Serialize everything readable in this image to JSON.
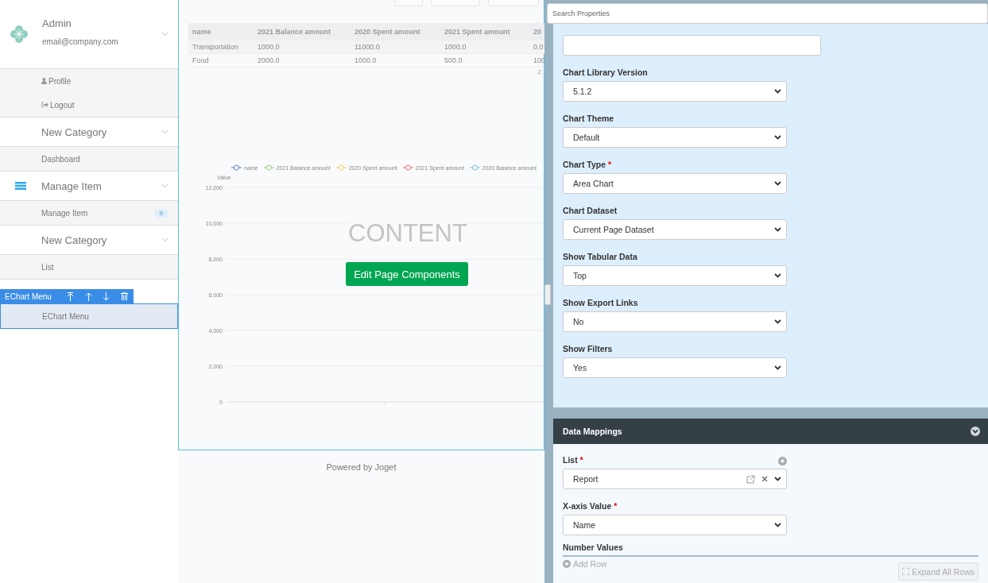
{
  "sidebar": {
    "profile": {
      "name": "Admin",
      "email": "email@company.com"
    },
    "profile_menu": [
      {
        "label": "Profile"
      },
      {
        "label": "Logout"
      }
    ],
    "menu": [
      {
        "label": "New Category",
        "icon": false,
        "children": [
          {
            "label": "Dashboard",
            "selected": false
          }
        ]
      },
      {
        "label": "Manage Item",
        "icon": true,
        "children": [
          {
            "label": "Manage Item",
            "badge": "0",
            "selected": false
          }
        ]
      },
      {
        "label": "New Category",
        "icon": false,
        "children": [
          {
            "label": "List",
            "selected": false
          },
          {
            "label": "EChart Menu",
            "selected": true
          }
        ]
      }
    ],
    "component_toolbar": {
      "label": "EChart Menu"
    }
  },
  "main": {
    "table": {
      "columns": [
        "name",
        "2021 Balance amount",
        "2020 Spent amount",
        "2021 Spent amount",
        "20"
      ],
      "rows": [
        [
          "Transportation",
          "1000.0",
          "11000.0",
          "1000.0",
          "0.0"
        ],
        [
          "Food",
          "2000.0",
          "1000.0",
          "500.0",
          "100"
        ]
      ],
      "footer": "2"
    },
    "chart_data": {
      "type": "line",
      "ylabel": "Value",
      "ylim": [
        0,
        12000
      ],
      "grid": true,
      "yticks": [
        {
          "value": 0,
          "label": "0"
        },
        {
          "value": 2000,
          "label": "2,000"
        },
        {
          "value": 4000,
          "label": "4,000"
        },
        {
          "value": 6000,
          "label": "6,000"
        },
        {
          "value": 8000,
          "label": "8,000"
        },
        {
          "value": 10000,
          "label": "10,000"
        },
        {
          "value": 12000,
          "label": "12,000"
        }
      ],
      "series": [
        {
          "name": "name",
          "color": "#5470c6"
        },
        {
          "name": "2021 Balance amount",
          "color": "#91cc75"
        },
        {
          "name": "2020 Spent amount",
          "color": "#fac858"
        },
        {
          "name": "2021 Spent amount",
          "color": "#ee6666"
        },
        {
          "name": "2020 Balance amount",
          "color": "#73c0de"
        }
      ]
    },
    "overlay_text": "CONTENT",
    "edit_button": "Edit Page Components",
    "footer": "Powered by Joget"
  },
  "properties": {
    "search": {
      "placeholder": "Search Properties"
    },
    "required_mark": "*",
    "fields": [
      {
        "kind": "text"
      },
      {
        "kind": "select",
        "label": "Chart Library Version",
        "value": "5.1.2",
        "required": false
      },
      {
        "kind": "select",
        "label": "Chart Theme",
        "value": "Default",
        "required": false
      },
      {
        "kind": "select",
        "label": "Chart Type",
        "value": "Area Chart",
        "required": true
      },
      {
        "kind": "select",
        "label": "Chart Dataset",
        "value": "Current Page Dataset",
        "required": false
      },
      {
        "kind": "select",
        "label": "Show Tabular Data",
        "value": "Top",
        "required": false
      },
      {
        "kind": "select",
        "label": "Show Export Links",
        "value": "No",
        "required": false
      },
      {
        "kind": "select",
        "label": "Show Filters",
        "value": "Yes",
        "required": false
      }
    ],
    "data_mappings": {
      "title": "Data Mappings",
      "fields": [
        {
          "kind": "list-select",
          "label": "List",
          "value": "Report",
          "required": true
        },
        {
          "kind": "select",
          "label": "X-axis Value",
          "value": "Name",
          "required": true
        }
      ],
      "number_values": {
        "label": "Number Values",
        "add_row": "Add Row",
        "expand_button": "Expand All Rows"
      }
    }
  }
}
